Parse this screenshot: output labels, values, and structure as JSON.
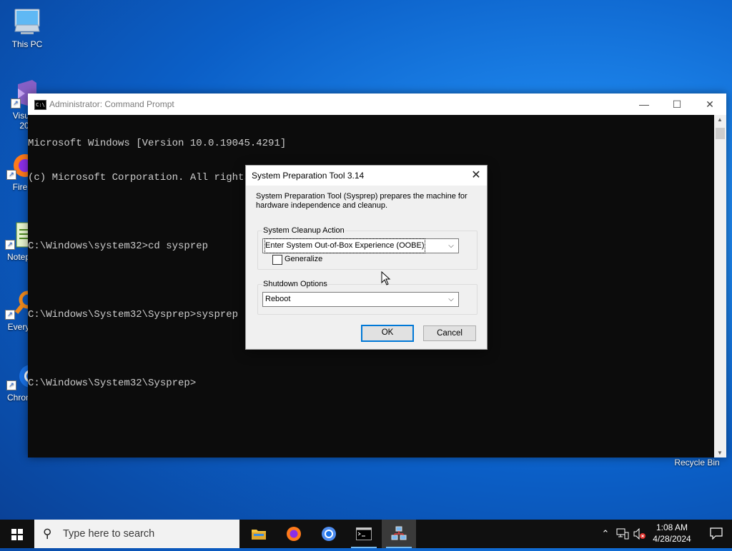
{
  "desktop": {
    "icons": [
      {
        "label": "This PC",
        "icon": "this-pc-icon"
      },
      {
        "label": "Visual\n20",
        "icon": "visual-studio-icon"
      },
      {
        "label": "Fire",
        "icon": "firefox-icon"
      },
      {
        "label": "Notep",
        "icon": "notepad-icon"
      },
      {
        "label": "Every",
        "icon": "everything-icon"
      },
      {
        "label": "Chrom",
        "icon": "chrome-icon"
      }
    ],
    "recycle_bin": "Recycle Bin"
  },
  "cmd": {
    "title": "Administrator: Command Prompt",
    "lines": [
      "Microsoft Windows [Version 10.0.19045.4291]",
      "(c) Microsoft Corporation. All rights reserved.",
      "",
      "C:\\Windows\\system32>cd sysprep",
      "",
      "C:\\Windows\\System32\\Sysprep>sysprep",
      "",
      "C:\\Windows\\System32\\Sysprep>"
    ]
  },
  "dialog": {
    "title": "System Preparation Tool 3.14",
    "description": "System Preparation Tool (Sysprep) prepares the machine for hardware independence and cleanup.",
    "cleanup_group_label": "System Cleanup Action",
    "cleanup_value": "Enter System Out-of-Box Experience (OOBE)",
    "generalize_label": "Generalize",
    "generalize_checked": false,
    "shutdown_group_label": "Shutdown Options",
    "shutdown_value": "Reboot",
    "ok_label": "OK",
    "cancel_label": "Cancel"
  },
  "taskbar": {
    "search_placeholder": "Type here to search",
    "time": "1:08 AM",
    "date": "4/28/2024"
  },
  "colors": {
    "accent": "#0078d7",
    "taskbar": "#101010",
    "console_bg": "#0c0c0c",
    "console_text": "#cccccc"
  }
}
